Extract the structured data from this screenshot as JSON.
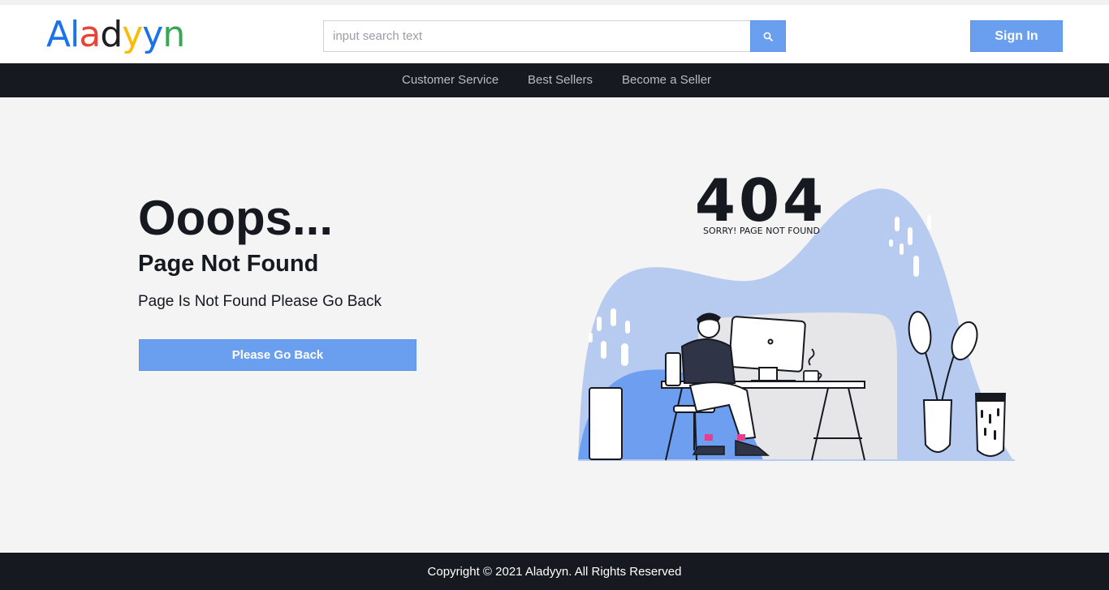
{
  "header": {
    "logo": {
      "letters": [
        {
          "char": "A",
          "color": "#1a73e8"
        },
        {
          "char": "l",
          "color": "#1a73e8"
        },
        {
          "char": "a",
          "color": "#ea4335"
        },
        {
          "char": "d",
          "color": "#1f1f1f"
        },
        {
          "char": "y",
          "color": "#fbbc05"
        },
        {
          "char": "y",
          "color": "#1a73e8"
        },
        {
          "char": "n",
          "color": "#34a853"
        }
      ]
    },
    "search": {
      "placeholder": "input search text",
      "icon": "search-icon"
    },
    "signin_label": "Sign In"
  },
  "nav": {
    "items": [
      {
        "label": "Customer Service"
      },
      {
        "label": "Best Sellers"
      },
      {
        "label": "Become a Seller"
      }
    ]
  },
  "main": {
    "headline": "Ooops...",
    "subtitle": "Page Not Found",
    "message": "Page Is Not Found Please Go Back",
    "button_label": "Please Go Back",
    "illustration": {
      "code": "404",
      "caption": "SORRY! PAGE NOT FOUND"
    }
  },
  "footer": {
    "copyright": "Copyright © 2021 Aladyyn. All Rights Reserved"
  },
  "colors": {
    "accent": "#6a9ff0",
    "dark": "#16191f",
    "background": "#f4f4f5",
    "blob": "#b7caef",
    "blob_dark": "#6e9ef0"
  }
}
